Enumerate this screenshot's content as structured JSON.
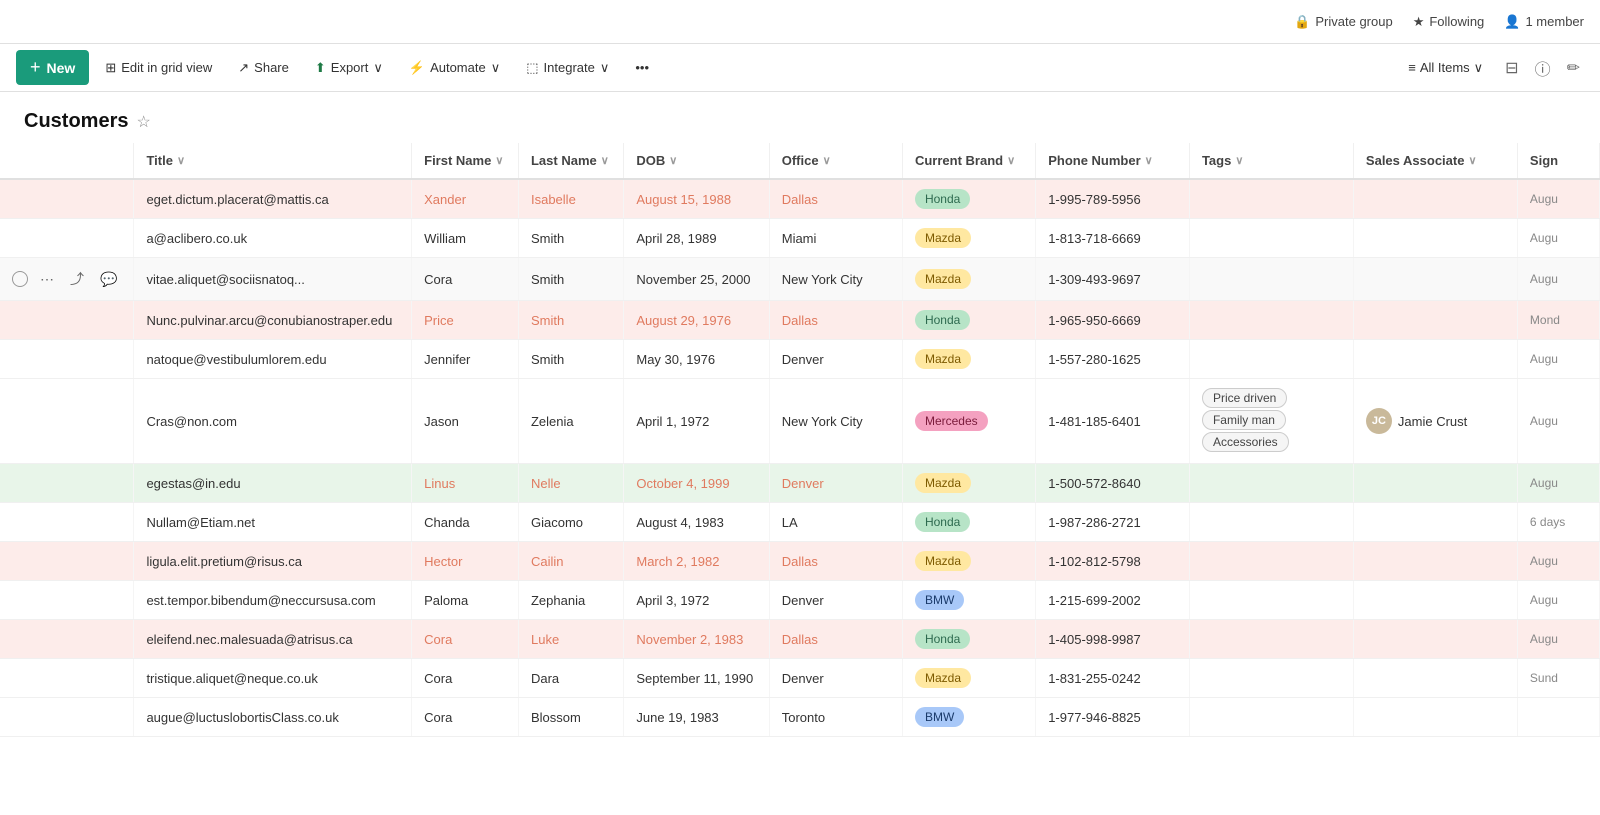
{
  "topBar": {
    "privateGroup": "Private group",
    "following": "Following",
    "members": "1 member"
  },
  "toolbar": {
    "newLabel": "New",
    "editGridView": "Edit in grid view",
    "share": "Share",
    "export": "Export",
    "automate": "Automate",
    "integrate": "Integrate",
    "more": "...",
    "allItems": "All Items"
  },
  "page": {
    "title": "Customers"
  },
  "table": {
    "columns": [
      "",
      "Title",
      "First Name",
      "Last Name",
      "DOB",
      "Office",
      "Current Brand",
      "Phone Number",
      "Tags",
      "Sales Associate",
      "Sign"
    ],
    "rows": [
      {
        "rowStyle": "row-pink",
        "title": "eget.dictum.placerat@mattis.ca",
        "firstName": "Xander",
        "firstNameStyle": "text-salmon",
        "lastName": "Isabelle",
        "lastNameStyle": "text-salmon",
        "dob": "August 15, 1988",
        "dobStyle": "text-salmon",
        "office": "Dallas",
        "officeStyle": "text-salmon",
        "brand": "Honda",
        "brandStyle": "badge-honda",
        "phone": "1-995-789-5956",
        "tags": [],
        "salesName": "",
        "signDate": "Augu"
      },
      {
        "rowStyle": "row-white",
        "title": "a@aclibero.co.uk",
        "firstName": "William",
        "firstNameStyle": "",
        "lastName": "Smith",
        "lastNameStyle": "",
        "dob": "April 28, 1989",
        "dobStyle": "",
        "office": "Miami",
        "officeStyle": "",
        "brand": "Mazda",
        "brandStyle": "badge-mazda",
        "phone": "1-813-718-6669",
        "tags": [],
        "salesName": "",
        "signDate": "Augu"
      },
      {
        "rowStyle": "row-hover",
        "title": "vitae.aliquet@sociisnatoq...",
        "firstName": "Cora",
        "firstNameStyle": "",
        "lastName": "Smith",
        "lastNameStyle": "",
        "dob": "November 25, 2000",
        "dobStyle": "",
        "office": "New York City",
        "officeStyle": "",
        "brand": "Mazda",
        "brandStyle": "badge-mazda",
        "phone": "1-309-493-9697",
        "tags": [],
        "salesName": "",
        "signDate": "Augu",
        "hasActions": true
      },
      {
        "rowStyle": "row-pink",
        "title": "Nunc.pulvinar.arcu@conubianostraper.edu",
        "firstName": "Price",
        "firstNameStyle": "text-salmon",
        "lastName": "Smith",
        "lastNameStyle": "text-salmon",
        "dob": "August 29, 1976",
        "dobStyle": "text-salmon",
        "office": "Dallas",
        "officeStyle": "text-salmon",
        "brand": "Honda",
        "brandStyle": "badge-honda",
        "phone": "1-965-950-6669",
        "tags": [],
        "salesName": "",
        "signDate": "Mond"
      },
      {
        "rowStyle": "row-white",
        "title": "natoque@vestibulumlorem.edu",
        "firstName": "Jennifer",
        "firstNameStyle": "",
        "lastName": "Smith",
        "lastNameStyle": "",
        "dob": "May 30, 1976",
        "dobStyle": "",
        "office": "Denver",
        "officeStyle": "",
        "brand": "Mazda",
        "brandStyle": "badge-mazda",
        "phone": "1-557-280-1625",
        "tags": [],
        "salesName": "",
        "signDate": "Augu"
      },
      {
        "rowStyle": "row-white",
        "title": "Cras@non.com",
        "firstName": "Jason",
        "firstNameStyle": "",
        "lastName": "Zelenia",
        "lastNameStyle": "",
        "dob": "April 1, 1972",
        "dobStyle": "",
        "office": "New York City",
        "officeStyle": "",
        "brand": "Mercedes",
        "brandStyle": "badge-mercedes",
        "phone": "1-481-185-6401",
        "tags": [
          "Price driven",
          "Family man",
          "Accessories"
        ],
        "salesName": "Jamie Crust",
        "signDate": "Augu"
      },
      {
        "rowStyle": "row-green",
        "title": "egestas@in.edu",
        "firstName": "Linus",
        "firstNameStyle": "text-salmon",
        "lastName": "Nelle",
        "lastNameStyle": "text-salmon",
        "dob": "October 4, 1999",
        "dobStyle": "text-salmon",
        "office": "Denver",
        "officeStyle": "text-salmon",
        "brand": "Mazda",
        "brandStyle": "badge-mazda",
        "phone": "1-500-572-8640",
        "tags": [],
        "salesName": "",
        "signDate": "Augu"
      },
      {
        "rowStyle": "row-white",
        "title": "Nullam@Etiam.net",
        "firstName": "Chanda",
        "firstNameStyle": "",
        "lastName": "Giacomo",
        "lastNameStyle": "",
        "dob": "August 4, 1983",
        "dobStyle": "",
        "office": "LA",
        "officeStyle": "",
        "brand": "Honda",
        "brandStyle": "badge-honda",
        "phone": "1-987-286-2721",
        "tags": [],
        "salesName": "",
        "signDate": "6 days"
      },
      {
        "rowStyle": "row-pink",
        "title": "ligula.elit.pretium@risus.ca",
        "firstName": "Hector",
        "firstNameStyle": "text-salmon",
        "lastName": "Cailin",
        "lastNameStyle": "text-salmon",
        "dob": "March 2, 1982",
        "dobStyle": "text-salmon",
        "office": "Dallas",
        "officeStyle": "text-salmon",
        "brand": "Mazda",
        "brandStyle": "badge-mazda",
        "phone": "1-102-812-5798",
        "tags": [],
        "salesName": "",
        "signDate": "Augu"
      },
      {
        "rowStyle": "row-white",
        "title": "est.tempor.bibendum@neccursusa.com",
        "firstName": "Paloma",
        "firstNameStyle": "",
        "lastName": "Zephania",
        "lastNameStyle": "",
        "dob": "April 3, 1972",
        "dobStyle": "",
        "office": "Denver",
        "officeStyle": "",
        "brand": "BMW",
        "brandStyle": "badge-bmw",
        "phone": "1-215-699-2002",
        "tags": [],
        "salesName": "",
        "signDate": "Augu"
      },
      {
        "rowStyle": "row-pink",
        "title": "eleifend.nec.malesuada@atrisus.ca",
        "firstName": "Cora",
        "firstNameStyle": "text-salmon",
        "lastName": "Luke",
        "lastNameStyle": "text-salmon",
        "dob": "November 2, 1983",
        "dobStyle": "text-salmon",
        "office": "Dallas",
        "officeStyle": "text-salmon",
        "brand": "Honda",
        "brandStyle": "badge-honda",
        "phone": "1-405-998-9987",
        "tags": [],
        "salesName": "",
        "signDate": "Augu"
      },
      {
        "rowStyle": "row-white",
        "title": "tristique.aliquet@neque.co.uk",
        "firstName": "Cora",
        "firstNameStyle": "",
        "lastName": "Dara",
        "lastNameStyle": "",
        "dob": "September 11, 1990",
        "dobStyle": "",
        "office": "Denver",
        "officeStyle": "",
        "brand": "Mazda",
        "brandStyle": "badge-mazda",
        "phone": "1-831-255-0242",
        "tags": [],
        "salesName": "",
        "signDate": "Sund"
      },
      {
        "rowStyle": "row-white",
        "title": "augue@luctuslobortisClass.co.uk",
        "firstName": "Cora",
        "firstNameStyle": "",
        "lastName": "Blossom",
        "lastNameStyle": "",
        "dob": "June 19, 1983",
        "dobStyle": "",
        "office": "Toronto",
        "officeStyle": "",
        "brand": "BMW",
        "brandStyle": "badge-bmw",
        "phone": "1-977-946-8825",
        "tags": [],
        "salesName": "",
        "signDate": ""
      }
    ]
  },
  "icons": {
    "star": "☆",
    "plus": "+",
    "grid": "⊞",
    "share": "↗",
    "export": "⬆",
    "automate": "⚡",
    "integrate": "⬚",
    "more": "•••",
    "filter": "⊟",
    "info": "ⓘ",
    "edit": "✏",
    "allItems": "≡",
    "chevron": "∨",
    "starFilled": "★",
    "lock": "🔒",
    "person": "👤",
    "ellipsis": "⋯",
    "share2": "⤴",
    "comment": "💬"
  }
}
